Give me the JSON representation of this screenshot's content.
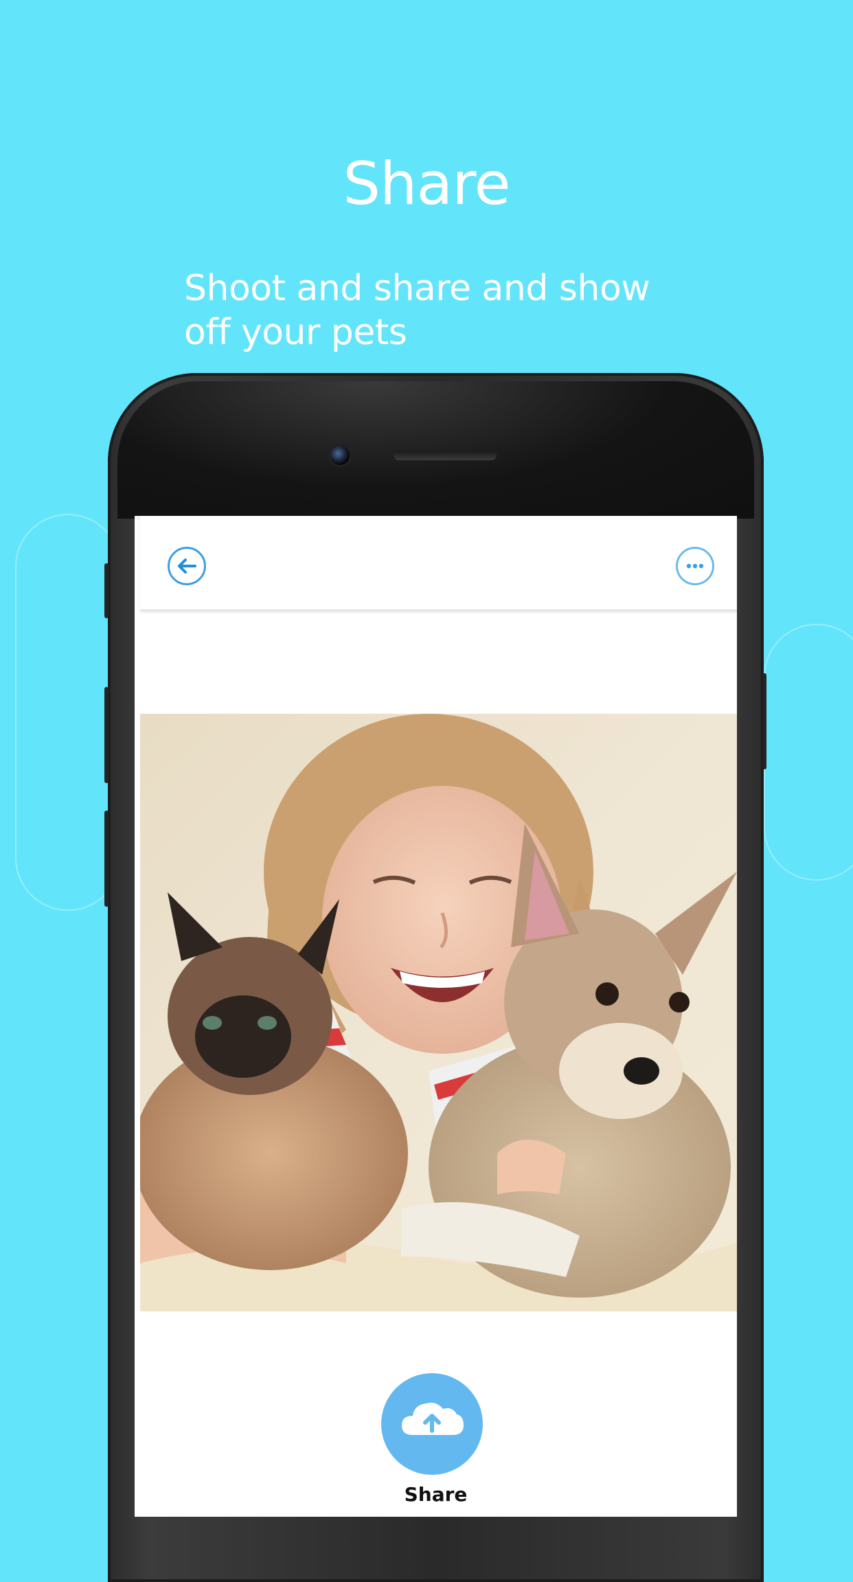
{
  "promo": {
    "title": "Share",
    "subtitle": "Shoot and share and show off your pets"
  },
  "app": {
    "navbar": {
      "back_icon": "arrow-left-circle-icon",
      "more_icon": "ellipsis-circle-icon"
    },
    "photo": {
      "subject": "girl-with-cat-and-dog-photo"
    },
    "share": {
      "icon": "cloud-upload-icon",
      "label": "Share"
    }
  },
  "colors": {
    "background": "#62e4fa",
    "accent": "#3aa0e3",
    "share_button": "#63b8ef"
  }
}
